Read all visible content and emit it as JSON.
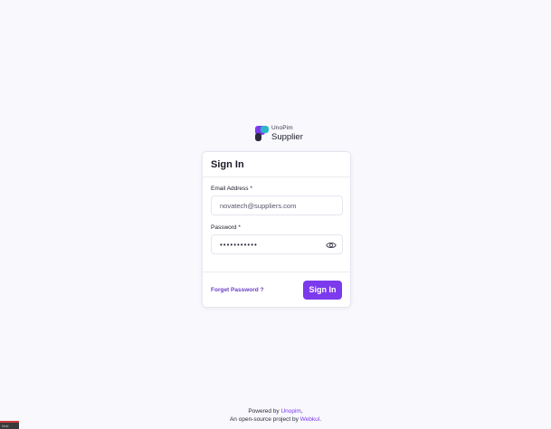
{
  "logo": {
    "brand": "UnoPim",
    "product": "Supplier",
    "colors": {
      "teal": "#2bb6c9",
      "purple": "#7c3aed",
      "dark": "#2a2a3d"
    }
  },
  "form": {
    "title": "Sign In",
    "email": {
      "label": "Email Address",
      "required_mark": "*",
      "value": "novatech@suppliers.com"
    },
    "password": {
      "label": "Password",
      "required_mark": "*",
      "value": "•••••••••••",
      "toggle_icon": "eye-icon"
    },
    "forgot_link": "Forget Password ?",
    "submit_label": "Sign In"
  },
  "footer": {
    "line1_prefix": "Powered by ",
    "line1_link": "Unopim",
    "line1_suffix": ",",
    "line2_prefix": "An open-source project by ",
    "line2_link": "Webkul",
    "line2_suffix": "."
  },
  "corner_tab": {
    "label": "Mail"
  },
  "theme": {
    "background": "#f8f8fd",
    "accent": "#7c3aed",
    "card": "#ffffff"
  }
}
